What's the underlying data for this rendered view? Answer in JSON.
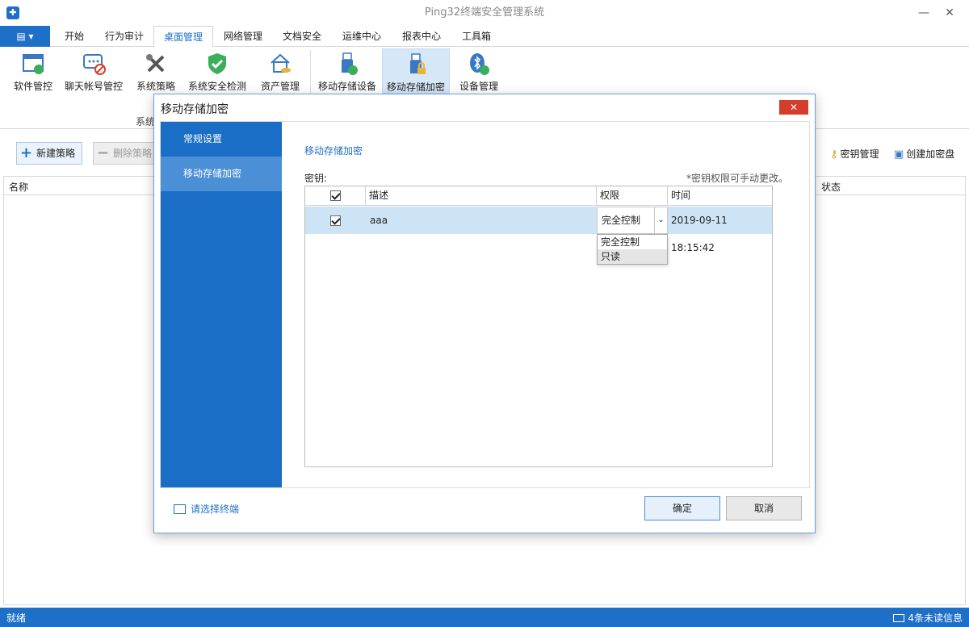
{
  "window": {
    "title": "Ping32终端安全管理系统",
    "minimize": "—",
    "maximize": "☐",
    "close": "✕"
  },
  "menu": {
    "app_button": "▤ ▾",
    "tabs": [
      "开始",
      "行为审计",
      "桌面管理",
      "网络管理",
      "文档安全",
      "运维中心",
      "报表中心",
      "工具箱"
    ],
    "active_tab": "桌面管理"
  },
  "ribbon": {
    "items": [
      "软件管控",
      "聊天帐号管控",
      "系统策略",
      "系统安全检测",
      "资产管理",
      "移动存储设备",
      "移动存储加密",
      "设备管理"
    ],
    "active_item": "移动存储加密",
    "group_label": "系统"
  },
  "toolbar": {
    "new_policy": "新建策略",
    "delete_policy": "删除策略",
    "key_management": "密钥管理",
    "create_encrypted_disk": "创建加密盘"
  },
  "list": {
    "col_name": "名称",
    "col_status": "状态"
  },
  "dialog": {
    "title": "移动存储加密",
    "close": "✕",
    "sidebar": [
      "常规设置",
      "移动存储加密"
    ],
    "active_sidebar": "移动存储加密",
    "section_title": "移动存储加密",
    "key_label": "密钥:",
    "key_note": "*密钥权限可手动更改。",
    "grid": {
      "headers": {
        "check": "",
        "desc": "描述",
        "permission": "权限",
        "time": "时间"
      },
      "rows": [
        {
          "checked": true,
          "desc": "aaa",
          "permission": "完全控制",
          "time": "2019-09-11 18:15:42"
        }
      ]
    },
    "dropdown_options": [
      "完全控制",
      "只读"
    ],
    "footer_link": "请选择终端",
    "ok": "确定",
    "cancel": "取消"
  },
  "status": {
    "left": "就绪",
    "right": "4条未读信息"
  },
  "colors": {
    "accent": "#1e6fc8",
    "sidebar": "#1a6ec5",
    "close_red": "#d43c2c",
    "selection": "#cde4f7"
  }
}
